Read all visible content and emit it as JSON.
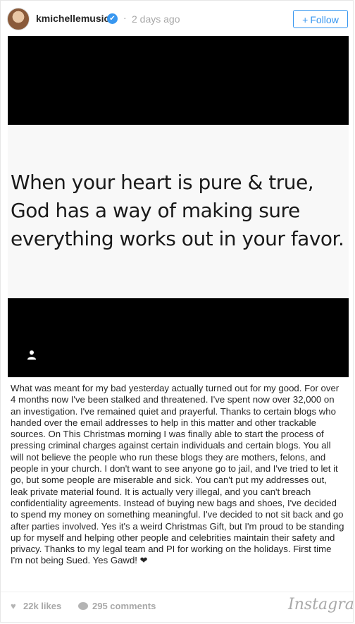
{
  "header": {
    "username": "kmichellemusic",
    "verified_icon": "✔",
    "separator": "·",
    "time": "2 days ago",
    "follow_plus": "+",
    "follow_label": "Follow",
    "accent": "#3897f0"
  },
  "media": {
    "quote_lines": [
      "When your heart is pure & true,",
      "God has a way of making sure",
      "everything works out in your favor."
    ]
  },
  "caption": "What was meant for my bad yesterday actually turned out for my good. For over 4 months now I've been stalked and threatened. I've spent now over 32,000 on an investigation. I've remained quiet and prayerful. Thanks to certain blogs who handed over the email addresses to help in this matter and other trackable sources. On This Christmas morning I was finally able to start the process of pressing criminal charges against certain individuals and certain blogs. You all will not believe the people who run these blogs they are mothers, felons, and people in your church. I don't want to see anyone go to jail, and I've tried to let it go, but some people are miserable and sick. You can't put my addresses out, leak private material found. It is actually very illegal, and you can't breach confidentiality agreements. Instead of buying new bags and shoes, I've decided to spend my money on something meaningful. I've decided to not sit back and go after parties involved. Yes it's a weird Christmas Gift, but I'm proud to be standing up for myself and helping other people and celebrities maintain their safety and privacy. Thanks to my legal team and PI for working on the holidays. First time I'm not being Sued. Yes Gawd! ❤",
  "footer": {
    "likes": "22k likes",
    "comments": "295 comments",
    "brand": "Instagram"
  }
}
